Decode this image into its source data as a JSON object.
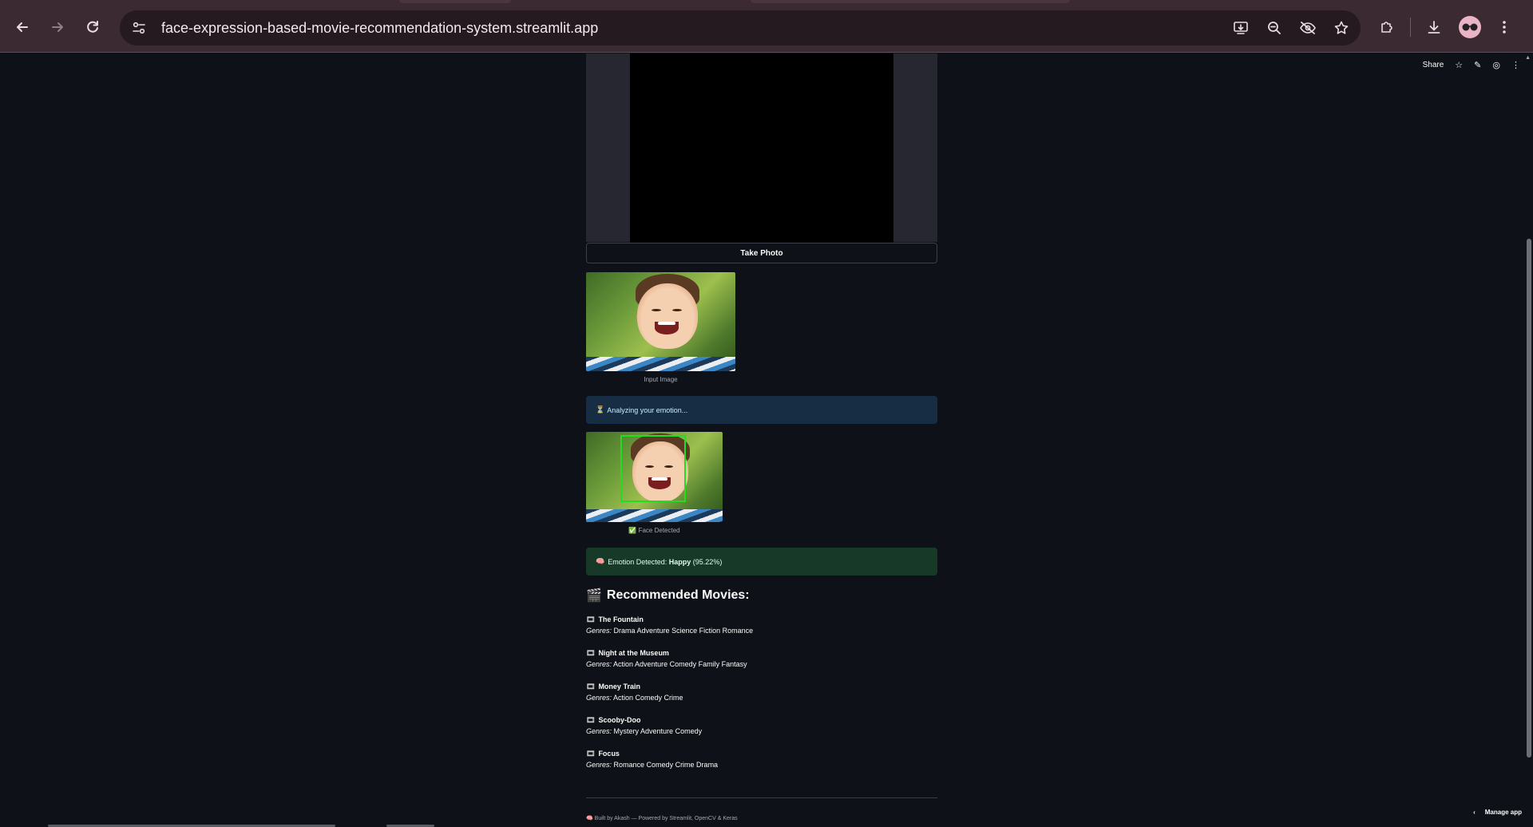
{
  "browser": {
    "url": "face-expression-based-movie-recommendation-system.streamlit.app",
    "nav": {
      "back_icon": "←",
      "forward_icon": "→",
      "reload_icon": "↻"
    },
    "omnibox_icons": [
      "install-app-icon",
      "zoom-icon",
      "tracking-protection-icon",
      "bookmark-star-icon"
    ],
    "toolbar_icons": [
      "extensions-icon",
      "downloads-icon",
      "profile-avatar",
      "menu-icon"
    ]
  },
  "streamlit_toolbar": {
    "share_label": "Share"
  },
  "camera": {
    "take_photo_label": "Take Photo"
  },
  "input_image": {
    "caption": "Input Image"
  },
  "analyzing": {
    "icon": "⏳",
    "text": "Analyzing your emotion..."
  },
  "face_image": {
    "caption_icon": "✅",
    "caption": "Face Detected"
  },
  "emotion": {
    "icon": "🧠",
    "prefix": "Emotion Detected: ",
    "label": "Happy",
    "confidence": "(95.22%)"
  },
  "recommendations": {
    "icon": "🎬",
    "title": "Recommended Movies:",
    "genres_label": "Genres:",
    "movies": [
      {
        "title": "The Fountain",
        "genres": "Drama Adventure Science Fiction Romance"
      },
      {
        "title": "Night at the Museum",
        "genres": "Action Adventure Comedy Family Fantasy"
      },
      {
        "title": "Money Train",
        "genres": "Action Comedy Crime"
      },
      {
        "title": "Scooby-Doo",
        "genres": "Mystery Adventure Comedy"
      },
      {
        "title": "Focus",
        "genres": "Romance Comedy Crime Drama"
      }
    ]
  },
  "footer": {
    "text": "🧠 Built by Akash — Powered by Streamlit, OpenCV & Keras"
  },
  "manage_app": {
    "label": "Manage app"
  },
  "colors": {
    "background": "#0e1117",
    "chrome": "#3b2a31",
    "info_bg": "#172d43",
    "success_bg": "#173928",
    "face_box": "#22dd22"
  }
}
